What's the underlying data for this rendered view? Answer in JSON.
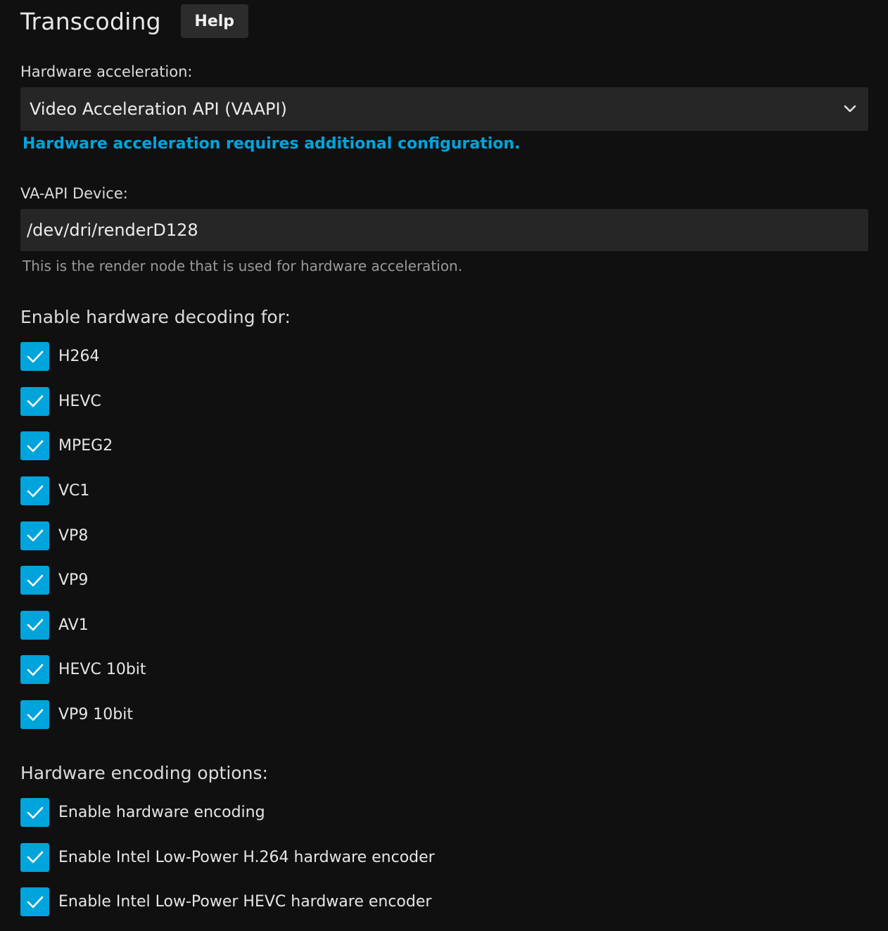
{
  "header": {
    "title": "Transcoding",
    "help_label": "Help"
  },
  "hardware_acceleration": {
    "label": "Hardware acceleration:",
    "selected": "Video Acceleration API (VAAPI)",
    "config_link": "Hardware acceleration requires additional configuration."
  },
  "vaapi_device": {
    "label": "VA-API Device:",
    "value": "/dev/dri/renderD128",
    "description": "This is the render node that is used for hardware acceleration."
  },
  "decoding": {
    "heading": "Enable hardware decoding for:",
    "items": [
      {
        "label": "H264",
        "checked": true
      },
      {
        "label": "HEVC",
        "checked": true
      },
      {
        "label": "MPEG2",
        "checked": true
      },
      {
        "label": "VC1",
        "checked": true
      },
      {
        "label": "VP8",
        "checked": true
      },
      {
        "label": "VP9",
        "checked": true
      },
      {
        "label": "AV1",
        "checked": true
      },
      {
        "label": "HEVC 10bit",
        "checked": true
      },
      {
        "label": "VP9 10bit",
        "checked": true
      }
    ]
  },
  "encoding": {
    "heading": "Hardware encoding options:",
    "items": [
      {
        "label": "Enable hardware encoding",
        "checked": true
      },
      {
        "label": "Enable Intel Low-Power H.264 hardware encoder",
        "checked": true
      },
      {
        "label": "Enable Intel Low-Power HEVC hardware encoder",
        "checked": true
      }
    ]
  },
  "colors": {
    "accent": "#00a4dc",
    "background": "#101010",
    "input_background": "#262626"
  },
  "icons": {
    "checkbox": "check-icon",
    "select": "chevron-down-icon"
  }
}
